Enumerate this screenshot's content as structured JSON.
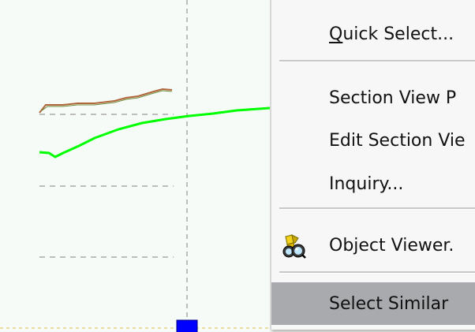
{
  "context_menu": {
    "items": [
      {
        "label": "Quick Select...",
        "shortcut_key": "Q",
        "label_rest": "uick Select...",
        "hovered": false
      },
      {
        "label": "Section View P",
        "hovered": false
      },
      {
        "label": "Edit Section Vie",
        "hovered": false
      },
      {
        "label": "Inquiry...",
        "hovered": false
      },
      {
        "label": "Object Viewer.",
        "icon": "binoculars-icon",
        "hovered": false
      },
      {
        "label": "Select Similar",
        "hovered": true
      }
    ],
    "hover_color": "#a9aaad"
  },
  "drawing": {
    "background_color": "#f7fbf7",
    "profile_line_color": "#00ff00",
    "brown_line_color": "#b0663a",
    "grip_color": "#0000ff"
  }
}
